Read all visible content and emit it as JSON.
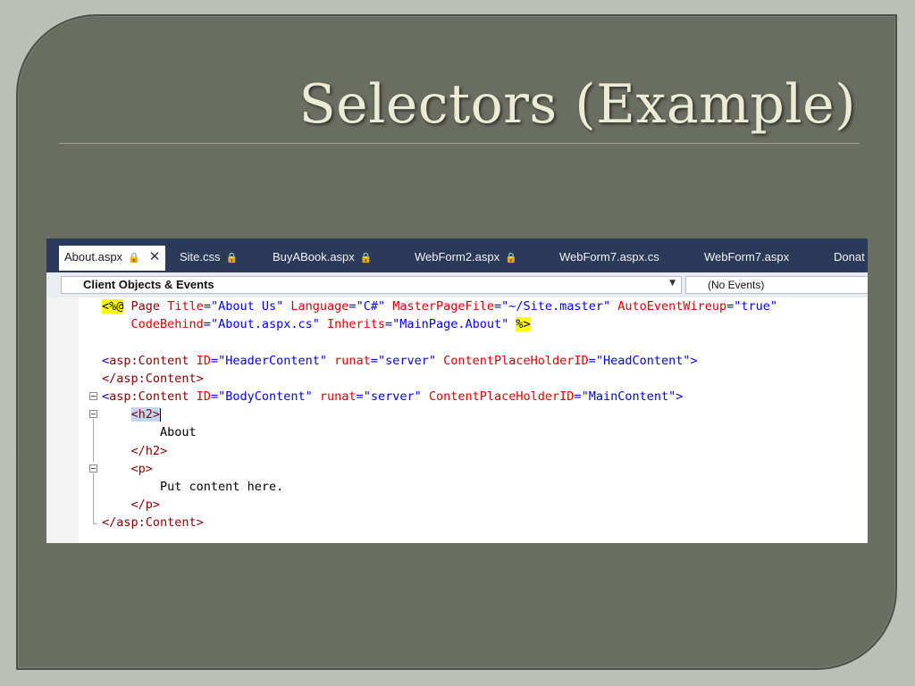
{
  "slide": {
    "title": "Selectors (Example)"
  },
  "editor": {
    "tabs": [
      {
        "label": "About.aspx",
        "active": true,
        "locked": true,
        "closable": true
      },
      {
        "label": "Site.css",
        "locked": true
      },
      {
        "label": "BuyABook.aspx",
        "locked": true
      },
      {
        "label": "WebForm2.aspx",
        "locked": true
      },
      {
        "label": "WebForm7.aspx.cs",
        "locked": false
      },
      {
        "label": "WebForm7.aspx",
        "locked": false
      },
      {
        "label": "Donat",
        "locked": false
      }
    ],
    "object_dropdown": "Client Objects & Events",
    "event_dropdown": "(No Events)",
    "icons": {
      "lock": "lock-icon",
      "close": "close-icon",
      "dropdown": "chevron-down-icon"
    },
    "code": {
      "l1_open": "<%",
      "l1_at": "@",
      "l1_kw": " Page ",
      "l1_a1": "Title",
      "l1_eq1": "=",
      "l1_v1": "\"About Us\"",
      "l1_a2": "Language",
      "l1_eq2": "=",
      "l1_v2": "\"C#\"",
      "l1_a3": "MasterPageFile",
      "l1_eq3": "=",
      "l1_v3": "\"~/Site.master\"",
      "l1_a4": "AutoEventWireup",
      "l1_eq4": "=",
      "l1_v4": "\"true\"",
      "l2_a1": "CodeBehind",
      "l2_eq1": "=",
      "l2_v1": "\"About.aspx.cs\"",
      "l2_a2": "Inherits",
      "l2_eq2": "=",
      "l2_v2": "\"MainPage.About\"",
      "l2_close": "%>",
      "l4_lt": "<",
      "l4_tag": "asp:Content",
      "l4_a1": "ID",
      "l4_v1": "\"HeaderContent\"",
      "l4_a2": "runat",
      "l4_v2": "\"server\"",
      "l4_a3": "ContentPlaceHolderID",
      "l4_v3": "\"HeadContent\"",
      "l4_gt": ">",
      "l5": "</asp:Content>",
      "l6_lt": "<",
      "l6_tag": "asp:Content",
      "l6_a1": "ID",
      "l6_v1": "\"BodyContent\"",
      "l6_a2": "runat",
      "l6_v2": "\"server\"",
      "l6_a3": "ContentPlaceHolderID",
      "l6_v3": "\"MainContent\"",
      "l6_gt": ">",
      "l7": "<h2>",
      "l8": "About",
      "l9": "</h2>",
      "l10": "<p>",
      "l11": "Put content here.",
      "l12": "</p>",
      "l13": "</asp:Content>"
    },
    "colors": {
      "tabbar": "#2b3a58",
      "tag": "#8b0000",
      "attribute": "#e00000",
      "value": "#0000ff",
      "directive_highlight": "#ffff00"
    }
  }
}
